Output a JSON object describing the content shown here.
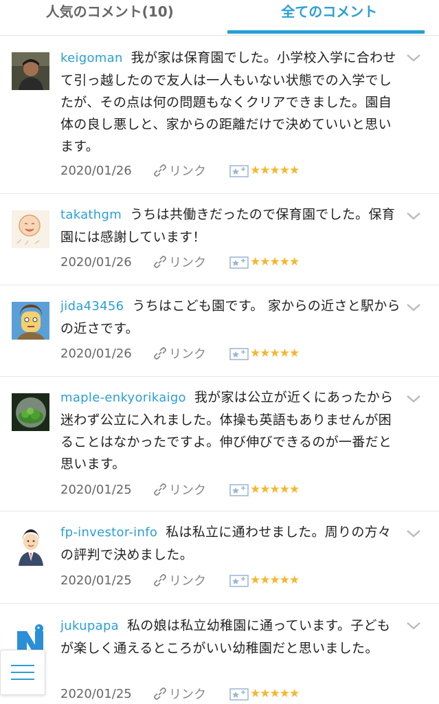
{
  "tabs": {
    "popular": "人気のコメント(10)",
    "all": "全てのコメント"
  },
  "link_label": "リンク",
  "stars": "★★★★★",
  "comments": [
    {
      "user": "keigoman",
      "text": "我が家は保育園でした。小学校入学に合わせて引っ越したので友人は一人もいない状態での入学でしたが、その点は何の問題もなくクリアできました。園自体の良し悪しと、家からの距離だけで決めていいと思います。",
      "date": "2020/01/26"
    },
    {
      "user": "takathgm",
      "text": "うちは共働きだったので保育園でした。保育園には感謝しています！",
      "date": "2020/01/26"
    },
    {
      "user": "jida43456",
      "text": "うちはこども園です。 家からの近さと駅からの近さです。",
      "date": "2020/01/26"
    },
    {
      "user": "maple-enkyorikaigo",
      "text": "我が家は公立が近くにあったから迷わず公立に入れました。体操も英語もありませんが困ることはなかったですよ。伸び伸びできるのが一番だと思います。",
      "date": "2020/01/25"
    },
    {
      "user": "fp-investor-info",
      "text": "私は私立に通わせました。周りの方々の評判で決めました。",
      "date": "2020/01/25"
    },
    {
      "user": "jukupapa",
      "text": "私の娘は私立幼稚園に通っています。子どもが楽しく通えるところがいい幼稚園だと思いました。",
      "date": "2020/01/25"
    }
  ]
}
